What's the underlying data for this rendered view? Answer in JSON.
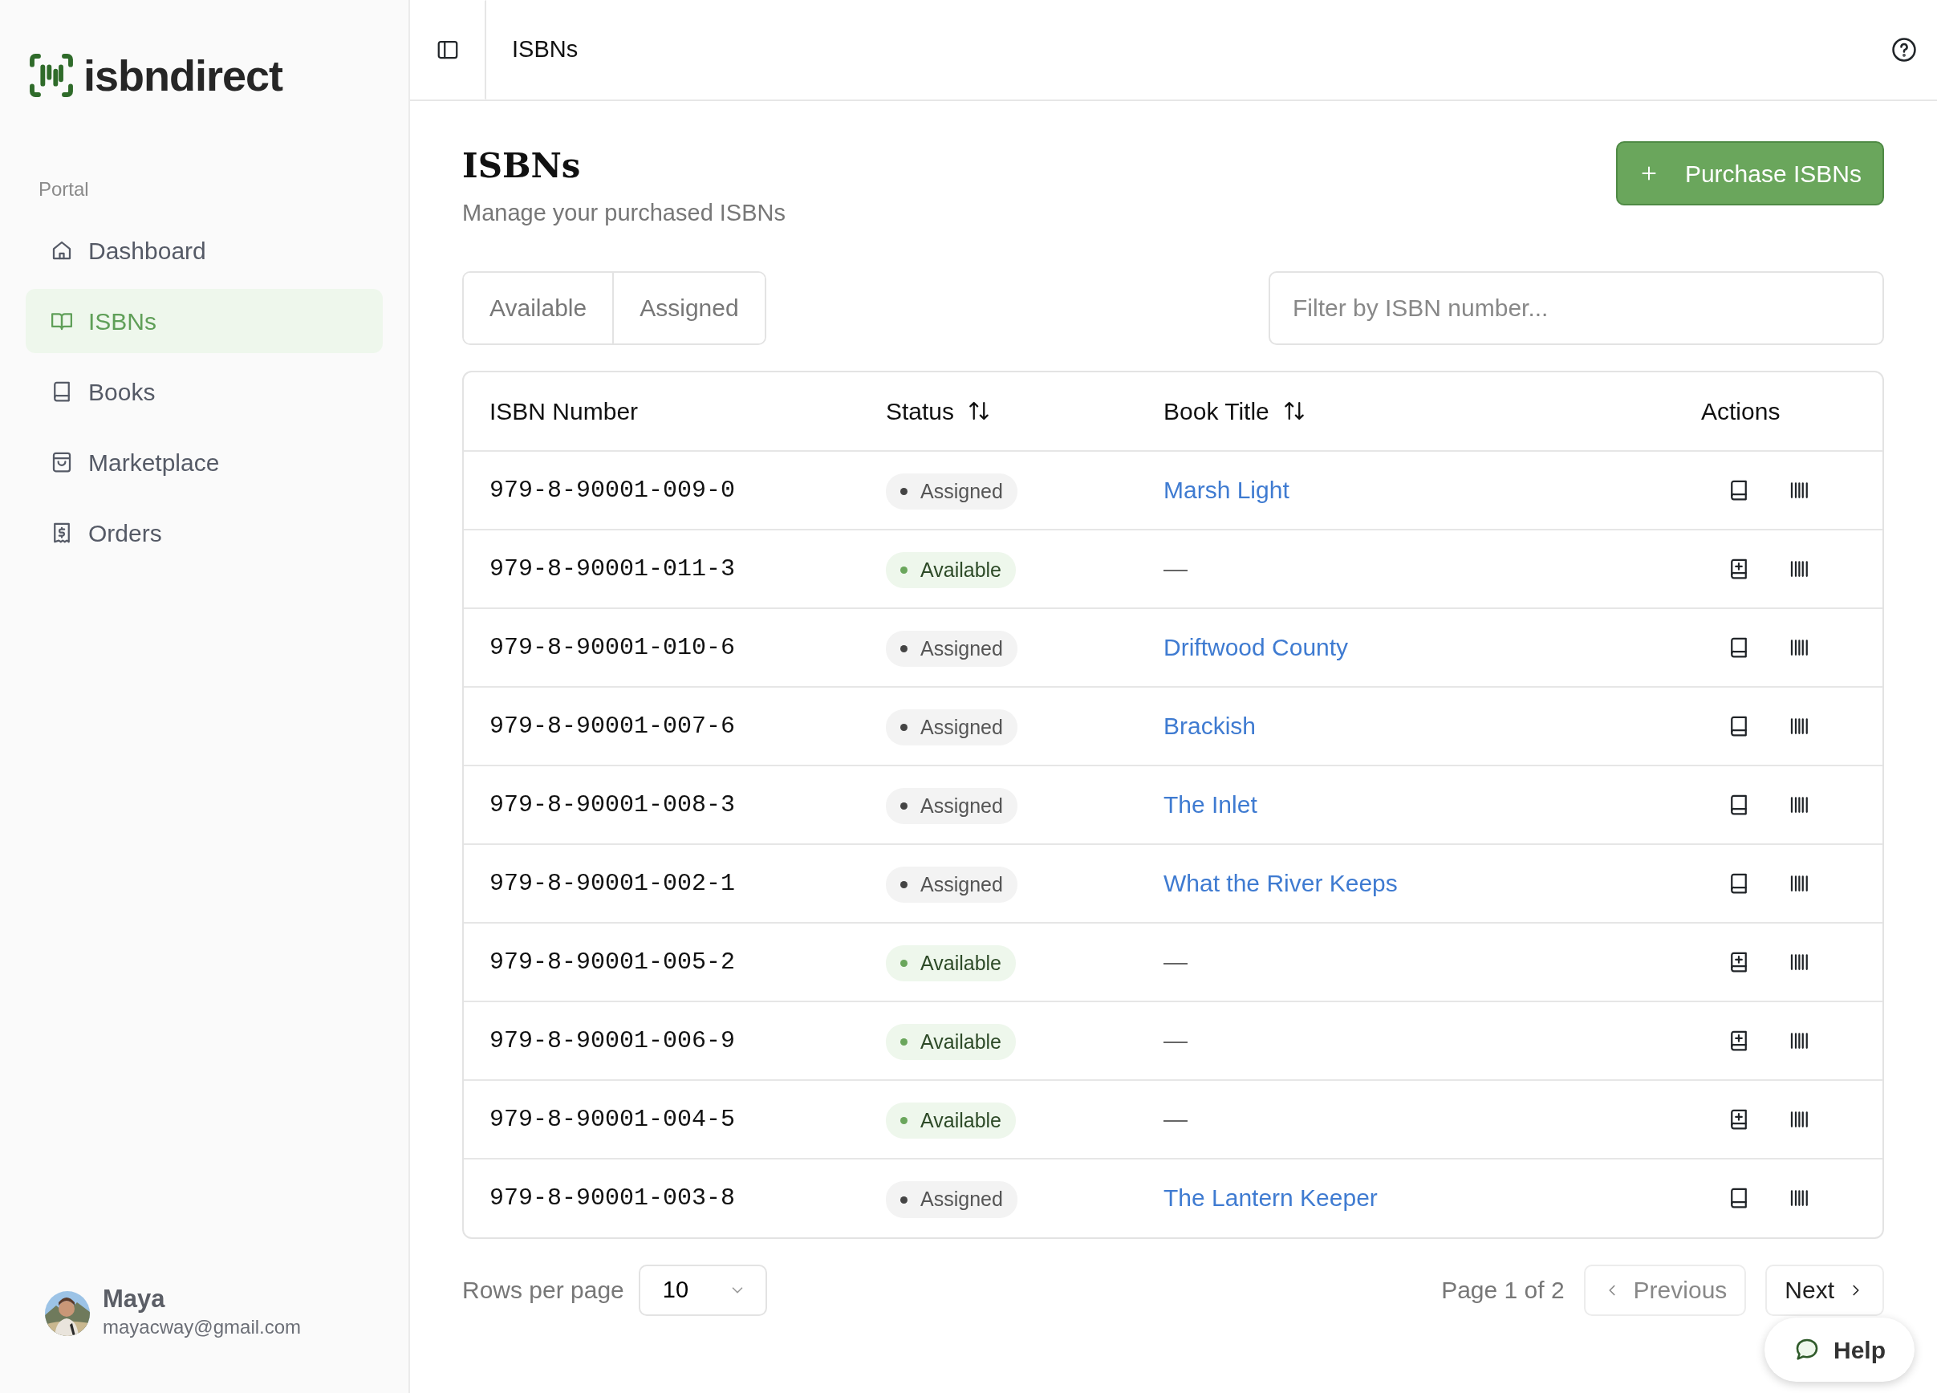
{
  "sidebar": {
    "logo": "isbndirect",
    "section": "Portal",
    "items": [
      {
        "label": "Dashboard",
        "selected": false
      },
      {
        "label": "ISBNs",
        "selected": true
      },
      {
        "label": "Books",
        "selected": false
      },
      {
        "label": "Marketplace",
        "selected": false
      },
      {
        "label": "Orders",
        "selected": false
      }
    ],
    "user": {
      "name": "Maya",
      "email": "mayacway@gmail.com"
    }
  },
  "header": {
    "title": "ISBNs"
  },
  "page": {
    "title": "ISBNs",
    "subtitle": "Manage your purchased ISBNs",
    "primary_button": "Purchase ISBNs"
  },
  "tabs": [
    {
      "label": "Available",
      "selected": false
    },
    {
      "label": "Assigned",
      "selected": false
    }
  ],
  "filter": {
    "placeholder": "Filter by ISBN number..."
  },
  "table": {
    "columns": [
      {
        "label": "ISBN Number",
        "sortable": false
      },
      {
        "label": "Status",
        "sortable": true
      },
      {
        "label": "Book Title",
        "sortable": true
      },
      {
        "label": "Actions",
        "sortable": false
      }
    ],
    "rows": [
      {
        "isbn": "979-8-90001-009-0",
        "status": "Assigned",
        "kind": "assigned",
        "title": "Marsh Light"
      },
      {
        "isbn": "979-8-90001-011-3",
        "status": "Available",
        "kind": "available",
        "title": "—"
      },
      {
        "isbn": "979-8-90001-010-6",
        "status": "Assigned",
        "kind": "assigned",
        "title": "Driftwood County"
      },
      {
        "isbn": "979-8-90001-007-6",
        "status": "Assigned",
        "kind": "assigned",
        "title": "Brackish"
      },
      {
        "isbn": "979-8-90001-008-3",
        "status": "Assigned",
        "kind": "assigned",
        "title": "The Inlet"
      },
      {
        "isbn": "979-8-90001-002-1",
        "status": "Assigned",
        "kind": "assigned",
        "title": "What the River Keeps"
      },
      {
        "isbn": "979-8-90001-005-2",
        "status": "Available",
        "kind": "available",
        "title": "—"
      },
      {
        "isbn": "979-8-90001-006-9",
        "status": "Available",
        "kind": "available",
        "title": "—"
      },
      {
        "isbn": "979-8-90001-004-5",
        "status": "Available",
        "kind": "available",
        "title": "—"
      },
      {
        "isbn": "979-8-90001-003-8",
        "status": "Assigned",
        "kind": "assigned",
        "title": "The Lantern Keeper"
      }
    ]
  },
  "pagination": {
    "rows_label": "Rows per page",
    "rows_value": "10",
    "page_text": "Page 1 of 2",
    "previous": "Previous",
    "next": "Next"
  },
  "help_button": "Help"
}
